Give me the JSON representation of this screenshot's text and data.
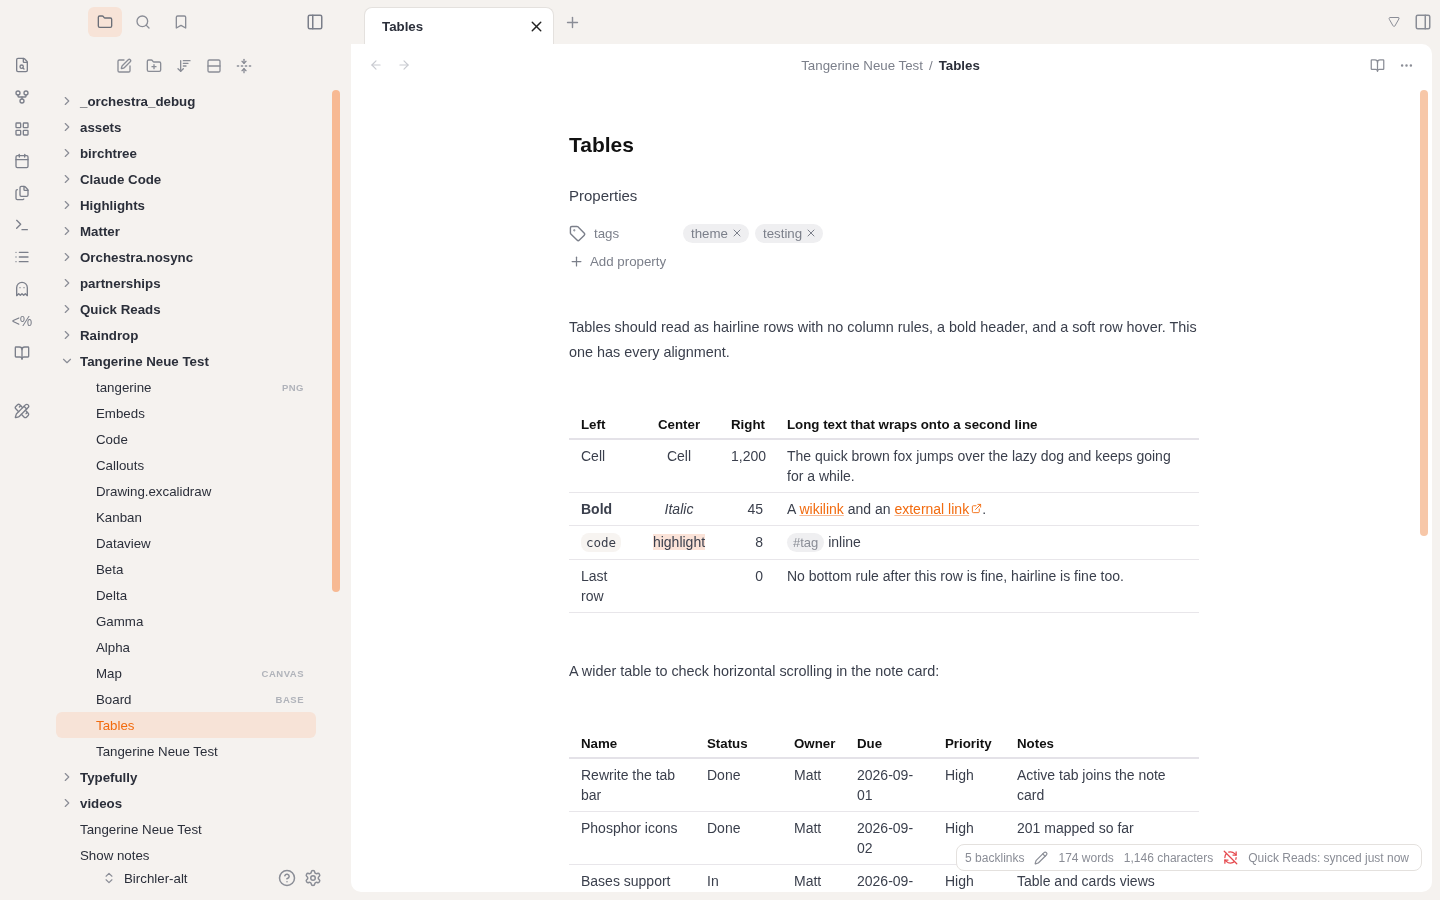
{
  "ribbon": [
    {
      "kind": "search-file"
    },
    {
      "kind": "graph"
    },
    {
      "kind": "grid"
    },
    {
      "kind": "calendar"
    },
    {
      "kind": "files"
    },
    {
      "kind": "terminal"
    },
    {
      "kind": "list"
    },
    {
      "kind": "ghost"
    },
    {
      "kind": "text",
      "text": "<%"
    },
    {
      "kind": "book"
    },
    {
      "kind": "tools"
    }
  ],
  "sidebar_tabs": [
    {
      "kind": "files",
      "selected": true
    },
    {
      "kind": "search",
      "selected": false
    },
    {
      "kind": "bookmarks",
      "selected": false
    }
  ],
  "tree": [
    {
      "label": "_orchestra_debug",
      "kind": "folder",
      "expanded": false,
      "selected": false
    },
    {
      "label": "assets",
      "kind": "folder",
      "expanded": false,
      "selected": false
    },
    {
      "label": "birchtree",
      "kind": "folder",
      "expanded": false,
      "selected": false
    },
    {
      "label": "Claude Code",
      "kind": "folder",
      "expanded": false,
      "selected": false
    },
    {
      "label": "Highlights",
      "kind": "folder",
      "expanded": false,
      "selected": false
    },
    {
      "label": "Matter",
      "kind": "folder",
      "expanded": false,
      "selected": false
    },
    {
      "label": "Orchestra.nosync",
      "kind": "folder",
      "expanded": false,
      "selected": false
    },
    {
      "label": "partnerships",
      "kind": "folder",
      "expanded": false,
      "selected": false
    },
    {
      "label": "Quick Reads",
      "kind": "folder",
      "expanded": false,
      "selected": false
    },
    {
      "label": "Raindrop",
      "kind": "folder",
      "expanded": false,
      "selected": false
    },
    {
      "label": "Tangerine Neue Test",
      "kind": "folder",
      "expanded": true,
      "selected": false,
      "children": [
        {
          "label": "tangerine",
          "kind": "file",
          "selected": false,
          "badge": "PNG"
        },
        {
          "label": "Embeds",
          "kind": "file",
          "selected": false
        },
        {
          "label": "Code",
          "kind": "file",
          "selected": false
        },
        {
          "label": "Callouts",
          "kind": "file",
          "selected": false
        },
        {
          "label": "Drawing.excalidraw",
          "kind": "file",
          "selected": false
        },
        {
          "label": "Kanban",
          "kind": "file",
          "selected": false
        },
        {
          "label": "Dataview",
          "kind": "file",
          "selected": false
        },
        {
          "label": "Beta",
          "kind": "file",
          "selected": false
        },
        {
          "label": "Delta",
          "kind": "file",
          "selected": false
        },
        {
          "label": "Gamma",
          "kind": "file",
          "selected": false
        },
        {
          "label": "Alpha",
          "kind": "file",
          "selected": false
        },
        {
          "label": "Map",
          "kind": "file",
          "selected": false,
          "badge": "CANVAS"
        },
        {
          "label": "Board",
          "kind": "file",
          "selected": false,
          "badge": "BASE"
        },
        {
          "label": "Tables",
          "kind": "file",
          "selected": true
        },
        {
          "label": "Tangerine Neue Test",
          "kind": "file",
          "selected": false
        }
      ]
    },
    {
      "label": "Typefully",
      "kind": "folder",
      "expanded": false,
      "selected": false
    },
    {
      "label": "videos",
      "kind": "folder",
      "expanded": false,
      "selected": false
    },
    {
      "label": "Tangerine Neue Test",
      "kind": "file",
      "selected": false
    },
    {
      "label": "Show notes",
      "kind": "file",
      "selected": false
    }
  ],
  "vault": {
    "name": "Birchler-alt"
  },
  "tabs": [
    {
      "title": "Tables",
      "selected": true
    }
  ],
  "breadcrumb": {
    "path": "Tangerine Neue Test",
    "separator": "/",
    "current": "Tables"
  },
  "note": {
    "title": "Tables",
    "properties_heading": "Properties",
    "properties": [
      {
        "name": "tags",
        "values": [
          "theme",
          "testing"
        ]
      }
    ],
    "add_property": "Add property",
    "blocks": [
      {
        "kind": "paragraph",
        "text": "Tables should read as hairline rows with no column rules, a bold header, and a soft row hover. This one has every alignment."
      },
      {
        "kind": "table",
        "columns": [
          "Left",
          "Center",
          "Right",
          "Long text that wraps onto a second line"
        ],
        "rows": [
          [
            "Cell",
            "Cell",
            "1,200",
            "The quick brown fox jumps over the lazy dog and keeps going for a while."
          ],
          [
            {
              "text": "Bold",
              "kind": "bold"
            },
            {
              "text": "Italic",
              "kind": "italic"
            },
            "45",
            [
              {
                "text": "A "
              },
              {
                "text": "wikilink",
                "kind": "link"
              },
              {
                "text": " and an "
              },
              {
                "text": "external link",
                "kind": "external"
              },
              {
                "text": "."
              }
            ]
          ],
          [
            {
              "text": "code",
              "kind": "code"
            },
            {
              "text": "highlight",
              "kind": "highlight"
            },
            "8",
            [
              {
                "text": "#tag",
                "kind": "tag"
              },
              {
                "text": " inline"
              }
            ]
          ],
          [
            "Last row",
            "",
            "0",
            "No bottom rule after this row is fine, hairline is fine too."
          ]
        ]
      },
      {
        "kind": "paragraph",
        "text": "A wider table to check horizontal scrolling in the note card:"
      },
      {
        "kind": "table",
        "columns": [
          "Name",
          "Status",
          "Owner",
          "Due",
          "Priority",
          "Notes"
        ],
        "rows": [
          [
            "Rewrite the tab bar",
            "Done",
            "Matt",
            "2026-09-01",
            "High",
            "Active tab joins the note card"
          ],
          [
            "Phosphor icons",
            "Done",
            "Matt",
            "2026-09-02",
            "High",
            "201 mapped so far"
          ],
          [
            "Bases support",
            "In",
            "Matt",
            "2026-09-",
            "High",
            "Table and cards views"
          ]
        ]
      }
    ]
  },
  "status_bar": {
    "backlinks": "5 backlinks",
    "words": "174 words",
    "characters": "1,146 characters",
    "sync": "Quick Reads: synced just now"
  }
}
